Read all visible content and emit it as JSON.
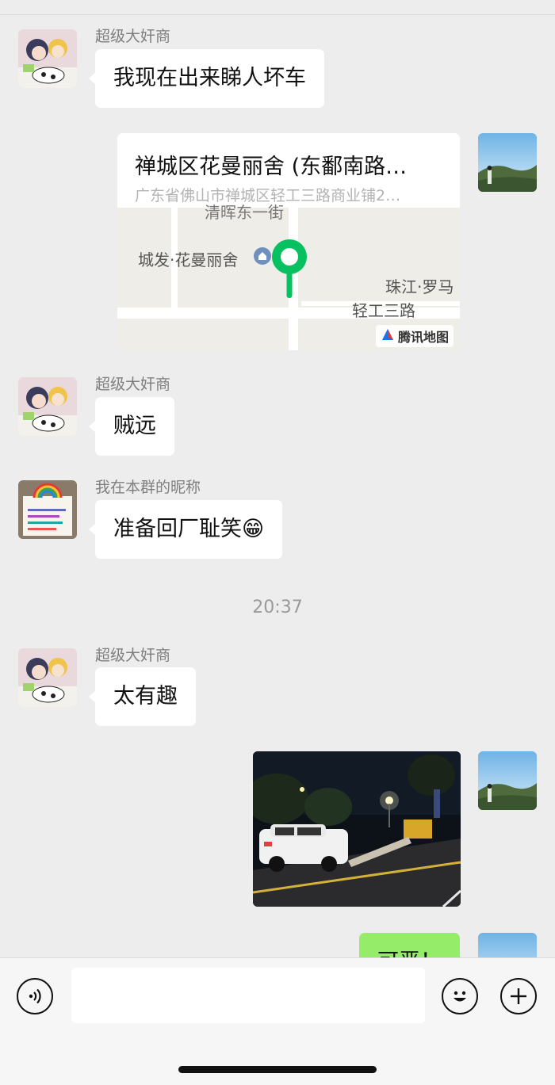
{
  "messages": {
    "m1": {
      "nick": "超级大奸商",
      "text": "我现在出来睇人坏车"
    },
    "m2": {
      "nick": "超级大奸商",
      "text": "贼远"
    },
    "m3": {
      "nick": "我在本群的昵称",
      "text": "准备回厂耻笑😁"
    },
    "m4": {
      "nick": "超级大奸商",
      "text": "太有趣"
    },
    "m5": {
      "text": "可恶！"
    }
  },
  "location": {
    "title": "禅城区花曼丽舍 (东鄱南路…",
    "address": "广东省佛山市禅城区轻工三路商业铺2…",
    "map_labels": {
      "poi": "城发·花曼丽舍",
      "top": "清晖东一街",
      "right": "珠江·罗马",
      "road": "轻工三路"
    },
    "brand": "腾讯地图"
  },
  "timestamp": "20:37",
  "input": {
    "placeholder": ""
  },
  "colors": {
    "sent_bubble": "#95ec69",
    "pin": "#07c160",
    "background": "#ededed"
  },
  "icons": {
    "voice": "voice-icon",
    "emoji": "emoji-icon",
    "plus": "plus-icon"
  }
}
